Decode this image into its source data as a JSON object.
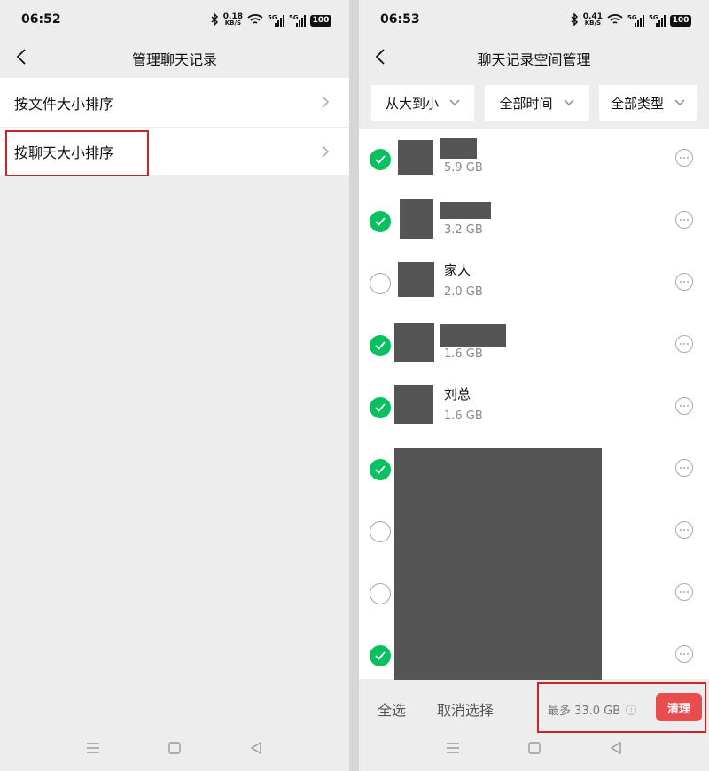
{
  "left": {
    "status": {
      "time": "06:52",
      "speed_value": "0.18",
      "speed_unit": "KB/S",
      "network": "5G",
      "battery": "100"
    },
    "title": "管理聊天记录",
    "menu": [
      {
        "label": "按文件大小排序"
      },
      {
        "label": "按聊天大小排序"
      }
    ]
  },
  "right": {
    "status": {
      "time": "06:53",
      "speed_value": "0.41",
      "speed_unit": "KB/S",
      "network": "5G",
      "battery": "100"
    },
    "title": "聊天记录空间管理",
    "filters": [
      {
        "label": "从大到小"
      },
      {
        "label": "全部时间"
      },
      {
        "label": "全部类型"
      }
    ],
    "rows": [
      {
        "name": "",
        "size": "5.9 GB",
        "checked": true
      },
      {
        "name": "",
        "size": "3.2 GB",
        "checked": true
      },
      {
        "name": "家人",
        "size": "2.0 GB",
        "checked": false
      },
      {
        "name": "",
        "size": "1.6 GB",
        "checked": true
      },
      {
        "name": "刘总",
        "size": "1.6 GB",
        "checked": true
      },
      {
        "name": "",
        "size": "",
        "checked": true
      },
      {
        "name": "",
        "size": "",
        "checked": false
      },
      {
        "name": "",
        "size": "",
        "checked": false
      },
      {
        "name": "",
        "size": "",
        "checked": true
      }
    ],
    "bottom": {
      "select_all": "全选",
      "cancel_selection": "取消选择",
      "summary": "最多 33.0 GB",
      "clean_button": "清理"
    }
  },
  "colors": {
    "accent_green": "#07c160",
    "danger_red": "#e84c4c",
    "highlight_box": "#c8262a"
  },
  "icons": [
    "back-arrow-icon",
    "chevron-right-icon",
    "chevron-down-icon",
    "check-icon",
    "more-icon",
    "info-icon",
    "bluetooth-icon",
    "wifi-icon",
    "signal-icon",
    "battery-icon",
    "menu-icon",
    "home-icon",
    "back-triangle-icon"
  ]
}
